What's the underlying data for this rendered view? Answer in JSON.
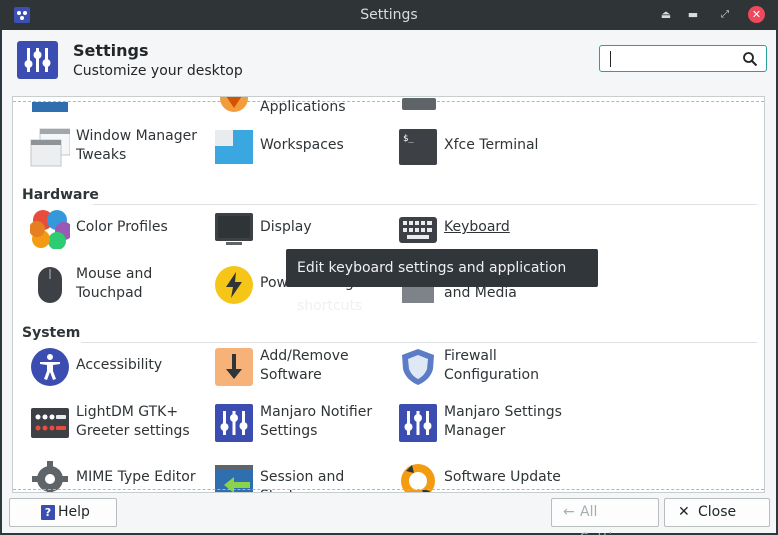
{
  "window": {
    "title": "Settings"
  },
  "header": {
    "title": "Settings",
    "subtitle": "Customize your desktop"
  },
  "search": {
    "placeholder": "",
    "value": ""
  },
  "partial_row": [
    {
      "label": "Applications"
    }
  ],
  "personal_items": [
    {
      "label": "Window Manager\nTweaks",
      "icon": "window-manager-tweaks-icon"
    },
    {
      "label": "Workspaces",
      "icon": "workspaces-icon"
    },
    {
      "label": "Xfce Terminal",
      "icon": "terminal-icon"
    }
  ],
  "categories": {
    "hardware": "Hardware",
    "system": "System"
  },
  "hardware_items": [
    {
      "label": "Color Profiles",
      "icon": "color-profiles-icon"
    },
    {
      "label": "Display",
      "icon": "display-icon"
    },
    {
      "label": "Keyboard",
      "icon": "keyboard-icon"
    },
    {
      "label": "Mouse and\nTouchpad",
      "icon": "mouse-icon"
    },
    {
      "label": "Power Manager",
      "icon": "power-manager-icon"
    },
    {
      "label": "and Media",
      "icon": "removable-drives-icon"
    }
  ],
  "system_items": [
    {
      "label": "Accessibility",
      "icon": "accessibility-icon"
    },
    {
      "label": "Add/Remove\nSoftware",
      "icon": "add-remove-software-icon"
    },
    {
      "label": "Firewall\nConfiguration",
      "icon": "firewall-icon"
    },
    {
      "label": "LightDM GTK+\nGreeter settings",
      "icon": "lightdm-icon"
    },
    {
      "label": "Manjaro Notifier\nSettings",
      "icon": "manjaro-notifier-icon"
    },
    {
      "label": "Manjaro Settings\nManager",
      "icon": "manjaro-settings-icon"
    },
    {
      "label": "MIME Type Editor",
      "icon": "mime-type-editor-icon"
    },
    {
      "label": "Session and Startup",
      "icon": "session-startup-icon"
    },
    {
      "label": "Software Update",
      "icon": "software-update-icon"
    }
  ],
  "tooltip": {
    "text": "Edit keyboard settings and application shortcuts"
  },
  "footer": {
    "help": "Help",
    "all_settings": "All Settings",
    "close": "Close"
  },
  "colors": {
    "accent": "#2aa198",
    "manjaro_blue": "#3b4db0",
    "close_red": "#f0495c"
  }
}
